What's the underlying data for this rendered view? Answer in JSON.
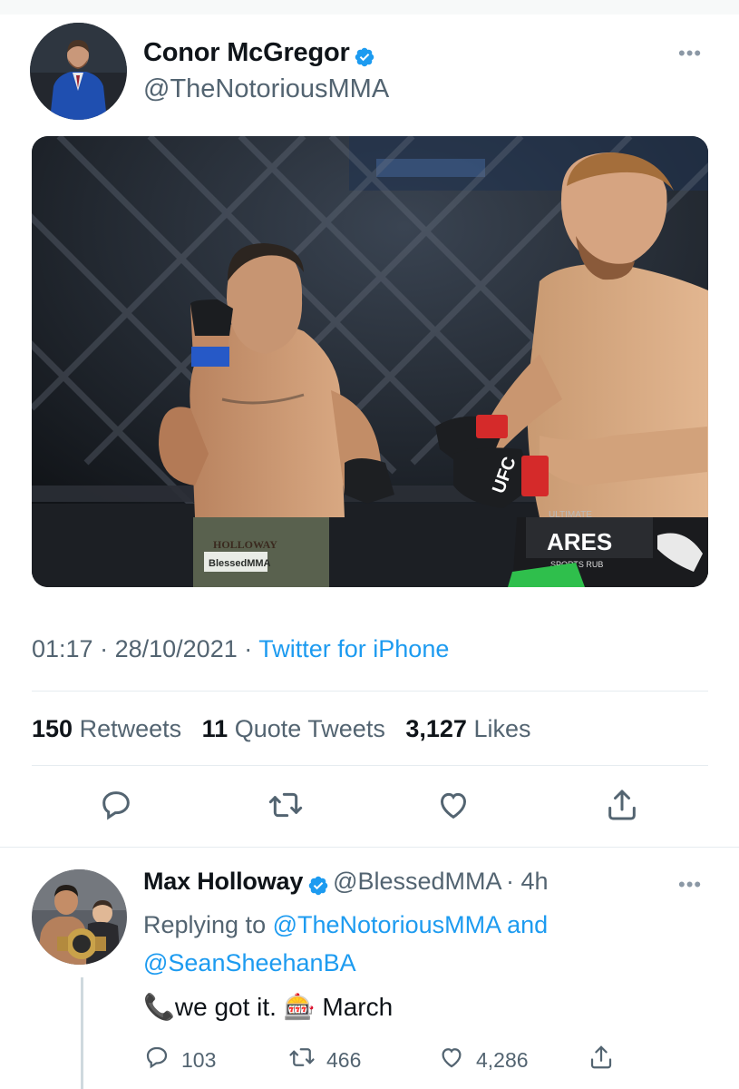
{
  "main_tweet": {
    "author_name": "Conor McGregor",
    "author_handle": "@TheNotoriousMMA",
    "more_icon": "more-dots-icon",
    "verified_icon": "verified-badge-icon",
    "media": {
      "shorts_left": "BlessedMMA",
      "shorts_left_belt": "HOLLOWAY",
      "glove_text": "UFC",
      "sponsor_brand": "ARES",
      "sponsor_sub": "SPORTS RUB",
      "sponsor_top": "ULTIMATE"
    },
    "time": "01:17",
    "date": "28/10/2021",
    "source": "Twitter for iPhone",
    "retweets_count": "150",
    "retweets_label": "Retweets",
    "quotes_count": "11",
    "quotes_label": "Quote Tweets",
    "likes_count": "3,127",
    "likes_label": "Likes",
    "actions": [
      "reply-icon",
      "retweet-icon",
      "like-icon",
      "share-icon"
    ]
  },
  "reply_tweet": {
    "author_name": "Max Holloway",
    "author_handle": "@BlessedMMA",
    "age": "4h",
    "replying_prefix": "Replying to",
    "replying_user1": "@TheNotoriousMMA",
    "replying_and": "and",
    "replying_user2": "@SeanSheehanBA",
    "text_part1": "we got it.",
    "text_part2": "March",
    "emoji_phone": "📞",
    "emoji_slot": "🎰",
    "reply_count": "103",
    "retweet_count": "466",
    "like_count": "4,286"
  },
  "colors": {
    "accent": "#1d9bf0",
    "secondary_text": "#536471",
    "primary_text": "#0f1419",
    "divider": "#e6ecf0"
  }
}
